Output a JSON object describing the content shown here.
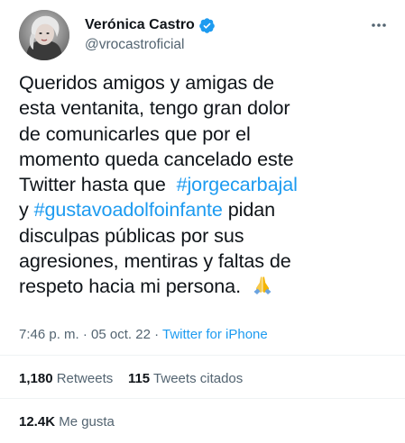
{
  "user": {
    "display_name": "Verónica Castro",
    "handle": "@vrocastroficial",
    "verified": true,
    "avatar_icon": "profile-photo"
  },
  "tweet": {
    "line1": "Queridos amigos y amigas de",
    "line2": "esta ventanita, tengo gran dolor",
    "line3": "de comunicarles que por el",
    "line4": "momento queda cancelado este",
    "line5_text": "Twitter hasta que",
    "line5_hashtag": "#jorgecarbajal",
    "line6_prefix": "y",
    "line6_hashtag": "#gustavoadolfoinfante",
    "line6_text": "pidan",
    "line7": "disculpas públicas por sus",
    "line8": "agresiones, mentiras y faltas de",
    "line9": "respeto hacia mi persona.",
    "emoji_icon": "folded-hands-icon"
  },
  "meta": {
    "time": "7:46 p. m.",
    "date": "05 oct. 22",
    "source": "Twitter for iPhone",
    "separator": "·"
  },
  "stats": {
    "retweets_count": "1,180",
    "retweets_label": "Retweets",
    "quotes_count": "115",
    "quotes_label": "Tweets citados",
    "likes_count": "12.4K",
    "likes_label": "Me gusta"
  },
  "colors": {
    "accent": "#1d9bf0",
    "text": "#0f1419",
    "secondary": "#536471",
    "divider": "#eff3f4"
  }
}
